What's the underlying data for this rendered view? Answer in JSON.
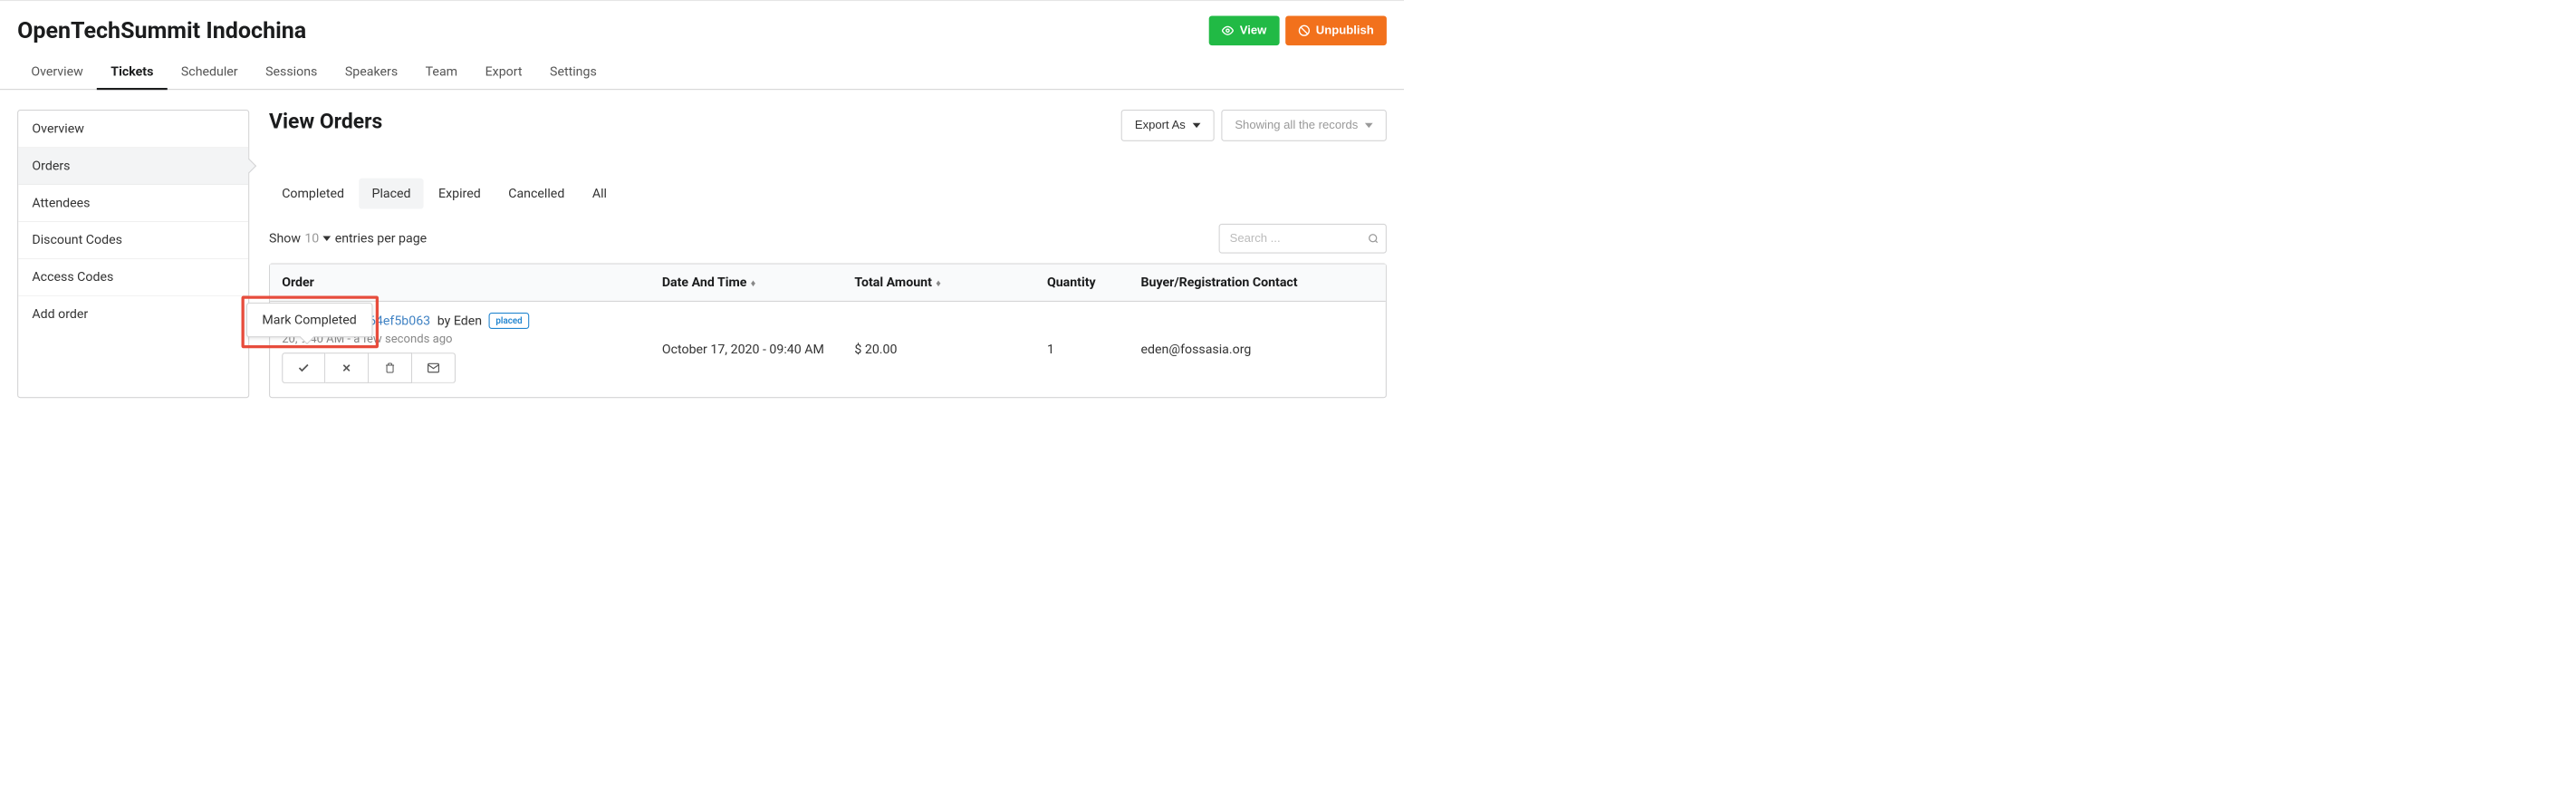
{
  "event_title": "OpenTechSummit Indochina",
  "header_buttons": {
    "view": "View",
    "unpublish": "Unpublish"
  },
  "nav_tabs": [
    "Overview",
    "Tickets",
    "Scheduler",
    "Sessions",
    "Speakers",
    "Team",
    "Export",
    "Settings"
  ],
  "nav_active": "Tickets",
  "sidebar_items": [
    "Overview",
    "Orders",
    "Attendees",
    "Discount Codes",
    "Access Codes",
    "Add order"
  ],
  "sidebar_active": "Orders",
  "page_title": "View Orders",
  "top_controls": {
    "export_as": "Export As",
    "showing": "Showing all the records"
  },
  "filter_tabs": [
    "Completed",
    "Placed",
    "Expired",
    "Cancelled",
    "All"
  ],
  "filter_active": "Placed",
  "entries": {
    "show": "Show",
    "num": "10",
    "suffix": "entries per page"
  },
  "search_placeholder": "Search ...",
  "columns": {
    "order": "Order",
    "date": "Date And Time",
    "amount": "Total Amount",
    "qty": "Quantity",
    "buyer": "Buyer/Registration Contact"
  },
  "rows": [
    {
      "order_id": "-4233-9c5f-b2164ef5b063",
      "by_prefix": "by",
      "by_name": "Eden",
      "status": "placed",
      "datetime_line": "20, 9:40 AM - a few seconds ago",
      "date": "October 17, 2020 - 09:40 AM",
      "amount": "$ 20.00",
      "qty": "1",
      "buyer": "eden@fossasia.org"
    }
  ],
  "tooltip": "Mark Completed"
}
